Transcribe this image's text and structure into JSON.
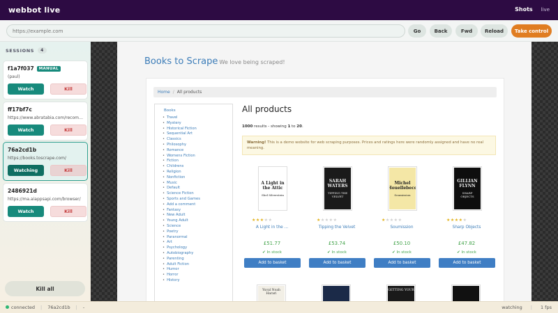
{
  "app": {
    "brand": "webbot live",
    "nav_shots": "Shots",
    "nav_live": "live"
  },
  "toolbar": {
    "url_placeholder": "https://example.com",
    "go": "Go",
    "back": "Back",
    "fwd": "Fwd",
    "reload": "Reload",
    "take_control": "Take control"
  },
  "sidebar": {
    "heading": "SESSIONS",
    "count": "4",
    "kill_all": "Kill all",
    "sessions": [
      {
        "id": "f1a7f037",
        "badge": "MANUAL",
        "sub": "(paul)",
        "watch": "Watch",
        "kill": "Kill"
      },
      {
        "id": "ff17bf7c",
        "sub": "https://www.abratabia.com/recomm...",
        "watch": "Watch",
        "kill": "Kill"
      },
      {
        "id": "76a2cd1b",
        "sub": "https://books.toscrape.com/",
        "watch": "Watching",
        "kill": "Kill"
      },
      {
        "id": "2486921d",
        "sub": "https://ma.aiappsapi.com/browser/",
        "watch": "Watch",
        "kill": "Kill"
      }
    ]
  },
  "page": {
    "site_title": "Books to Scrape",
    "site_tagline": "We love being scraped!",
    "crumb_home": "Home",
    "crumb_sep": "/",
    "crumb_current": "All products",
    "category_title": "Books",
    "categories": [
      "Travel",
      "Mystery",
      "Historical Fiction",
      "Sequential Art",
      "Classics",
      "Philosophy",
      "Romance",
      "Womens Fiction",
      "Fiction",
      "Childrens",
      "Religion",
      "Nonfiction",
      "Music",
      "Default",
      "Science Fiction",
      "Sports and Games",
      "Add a comment",
      "Fantasy",
      "New Adult",
      "Young Adult",
      "Science",
      "Poetry",
      "Paranormal",
      "Art",
      "Psychology",
      "Autobiography",
      "Parenting",
      "Adult Fiction",
      "Humor",
      "Horror",
      "History"
    ],
    "main_title": "All products",
    "results_count": "1000",
    "results_mid": " results - showing ",
    "results_from": "1",
    "results_to_word": " to ",
    "results_to": "20",
    "results_end": ".",
    "warning_label": "Warning!",
    "warning_text": " This is a demo website for web scraping purposes. Prices and ratings here were randomly assigned and have no real meaning.",
    "basket": "Add to basket",
    "products": [
      {
        "title": "A Light in the ...",
        "price": "£51.77",
        "stock": "In stock",
        "rating": 3,
        "cover": [
          "A Light in the Attic",
          "Shel Silverstein"
        ],
        "cover_color": "#ffffff"
      },
      {
        "title": "Tipping the Velvet",
        "price": "£53.74",
        "stock": "In stock",
        "rating": 1,
        "cover": [
          "SARAH WATERS",
          "TIPPING THE VELVET"
        ],
        "cover_color": "#1a1a1a"
      },
      {
        "title": "Soumission",
        "price": "£50.10",
        "stock": "In stock",
        "rating": 1,
        "cover": [
          "Michel Houellebecq",
          "Soumission"
        ],
        "cover_color": "#f4e7a6"
      },
      {
        "title": "Sharp Objects",
        "price": "£47.82",
        "stock": "In stock",
        "rating": 4,
        "cover": [
          "GILLIAN FLYNN",
          "SHARP OBJECTS"
        ],
        "cover_color": "#0e0e0e"
      }
    ],
    "next_covers": [
      {
        "text": "Yuval Noah Harari",
        "color": "#f2efe6"
      },
      {
        "text": "",
        "color": "#1b2a48"
      },
      {
        "text": "GETTING YOUR",
        "color": "#1a1a1a"
      },
      {
        "text": "",
        "color": "#111111"
      }
    ]
  },
  "status": {
    "connected": "connected",
    "session": "76a2cd1b",
    "dash": "-",
    "mode": "watching",
    "fps": "1 fps"
  }
}
